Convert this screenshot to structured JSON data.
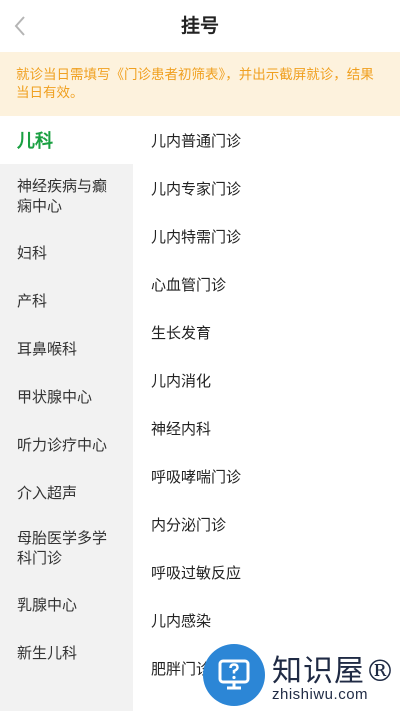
{
  "header": {
    "title": "挂号",
    "back_icon": "chevron-left-icon"
  },
  "notice": {
    "text": "就诊当日需填写《门诊患者初筛表》，并出示截屏就诊，结果当日有效。"
  },
  "sidebar": {
    "items": [
      {
        "label": "儿科",
        "active": true
      },
      {
        "label": "神经疾病与癫痫中心"
      },
      {
        "label": "妇科"
      },
      {
        "label": "产科"
      },
      {
        "label": "耳鼻喉科"
      },
      {
        "label": "甲状腺中心"
      },
      {
        "label": "听力诊疗中心"
      },
      {
        "label": "介入超声"
      },
      {
        "label": "母胎医学多学科门诊"
      },
      {
        "label": "乳腺中心"
      },
      {
        "label": "新生儿科"
      }
    ]
  },
  "clinics": {
    "items": [
      "儿内普通门诊",
      "儿内专家门诊",
      "儿内特需门诊",
      "心血管门诊",
      "生长发育",
      "儿内消化",
      "神经内科",
      "呼吸哮喘门诊",
      "内分泌门诊",
      "呼吸过敏反应",
      "儿内感染",
      "肥胖门诊"
    ]
  },
  "watermark": {
    "main": "知识屋®",
    "sub": "zhishiwu.com"
  },
  "colors": {
    "accent": "#1aa042",
    "notice_bg": "#fdf2dd",
    "notice_text": "#f0a020",
    "sidebar_bg": "#f2f2f2"
  }
}
